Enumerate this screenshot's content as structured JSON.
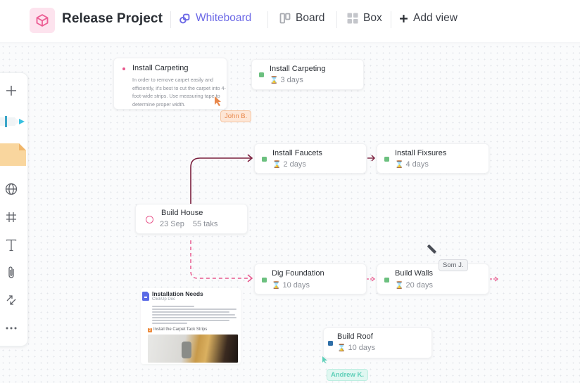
{
  "header": {
    "project_icon": "cube-icon",
    "project_title": "Release Project",
    "views": [
      {
        "label": "Whiteboard",
        "icon": "whiteboard-icon",
        "active": true
      },
      {
        "label": "Board",
        "icon": "board-icon",
        "active": false
      },
      {
        "label": "Box",
        "icon": "box-grid-icon",
        "active": false
      }
    ],
    "add_view_label": "Add view",
    "accent_color": "#6b68e6"
  },
  "toolbar": {
    "tools": [
      {
        "name": "add",
        "icon": "plus-icon"
      },
      {
        "name": "pen",
        "icon": "marker-pen-icon"
      },
      {
        "name": "sticky-note",
        "icon": "sticky-note-icon"
      },
      {
        "name": "web-embed",
        "icon": "globe-icon"
      },
      {
        "name": "frame",
        "icon": "hashtag-frame-icon"
      },
      {
        "name": "text",
        "icon": "text-icon"
      },
      {
        "name": "attachment",
        "icon": "paperclip-icon"
      },
      {
        "name": "connector",
        "icon": "connector-arrows-icon"
      },
      {
        "name": "more",
        "icon": "more-dots-icon"
      }
    ]
  },
  "note": {
    "title": "Install Carpeting",
    "body": "In order to remove carpet easily and efficiently, it's best to cut the carpet into 4-foot-wide strips. Use measuring tape to determine proper width.",
    "bullet_color": "#e8588d"
  },
  "tasks": [
    {
      "id": "install-carpeting",
      "title": "Install Carpeting",
      "duration": "3 days",
      "status_color": "#6cc07f"
    },
    {
      "id": "install-faucets",
      "title": "Install Faucets",
      "duration": "2 days",
      "status_color": "#6cc07f"
    },
    {
      "id": "install-fixsures",
      "title": "Install Fixsures",
      "duration": "4 days",
      "status_color": "#6cc07f"
    },
    {
      "id": "dig-foundation",
      "title": "Dig Foundation",
      "duration": "10 days",
      "status_color": "#6cc07f"
    },
    {
      "id": "build-walls",
      "title": "Build Walls",
      "duration": "20 days",
      "status_color": "#6cc07f"
    },
    {
      "id": "build-roof",
      "title": "Build Roof",
      "duration": "10 days",
      "status_color": "#2f6fa8"
    }
  ],
  "milestone": {
    "title": "Build House",
    "date": "23 Sep",
    "tasks_count": "55 taks",
    "ring_color": "#e8588d"
  },
  "doc": {
    "title": "Installation Needs",
    "subtitle": "ClickUp Doc",
    "step_number": "2",
    "step_label": "Install the Carpet Tack Strips"
  },
  "collaborators": [
    {
      "name": "John B.",
      "color": "#e8874a",
      "bg": "#fde6d6"
    },
    {
      "name": "Som J.",
      "color": "#5a5e66",
      "bg": "#f3f4f6"
    },
    {
      "name": "Andrew K.",
      "color": "#5ecfb8",
      "bg": "#e0f7f1"
    }
  ],
  "connectors": {
    "solid_color": "#7a1f3d",
    "dashed_color": "#e8588d"
  }
}
